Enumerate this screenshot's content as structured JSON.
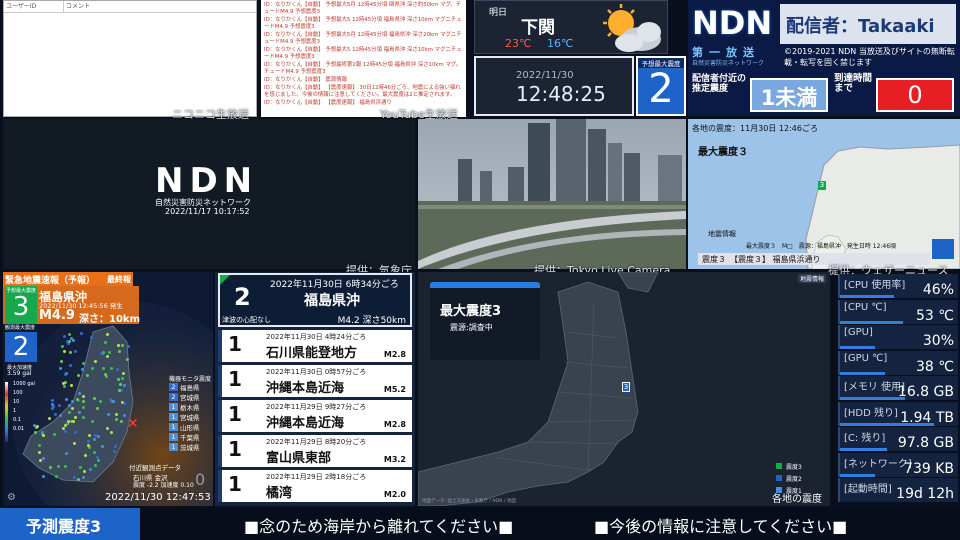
{
  "niconico": {
    "col_user": "ユーザーID",
    "col_comment": "コメント",
    "caption": "ニコニコ生放送"
  },
  "youtube": {
    "caption": "YouTube生放送",
    "comments": [
      "ID：なりかくん【自動】 予想最大5月 12時45分頃 関県沖 深さ約50km マグ。チュードM4.9 予想震度3",
      "ID：なりかくん【自動】 予想最大5 12時45分頃 福島県沖 深さ10km マグニチュードM4.9 予想震度3",
      "ID：なりかくん【自動】 予想最大5月 12時45分頃 福島県沖 深さ20km マグニチュードM4.9 予想震度3",
      "ID：なりかくん【自動】 予想最大5 12時45分頃 福島県沖 深さ10km マグニチュードM4.9 予想震度3",
      "ID：なりかくん【自動】 予想最終第2報 12時45分頃 福島県沖 深さ10km マグ。チュードM4.9 予想震度3",
      "ID：なりかくん【自動】 震源情報",
      "ID：なりかくん【自動】 【震度速報】 30日12時46分ごろ、地震による強い揺れを感じました。今後の情報に注意してください。最大震度は2と推定されます。",
      "ID：なりかくん【自動】 【震度速報】 福島県浜通り"
    ]
  },
  "weather": {
    "label": "明日",
    "city": "下関",
    "high": "23℃",
    "low": "16℃"
  },
  "clock": {
    "date": "2022/11/30",
    "time": "12:48:25",
    "max_label": "予想最大震度",
    "max_value": "2"
  },
  "ndn": {
    "logo": "NDN",
    "streamer": "配信者：Takaaki",
    "sub_logo": "第一放送",
    "sub_logo2": "自然災害防災ネットワーク",
    "copyright": "©2019-2021 NDN 当放送及びサイトの無断転載・転写を固く禁じます",
    "est_label": "配信者付近の推定震度",
    "est_value": "1未満",
    "arrival_label": "到達時間まで",
    "arrival_value": "0"
  },
  "ndn_video": {
    "logo": "NDN",
    "subtitle": "自然災害防災ネットワーク",
    "date": "2022/11/17 10:17:52"
  },
  "camera": {
    "caption": "提供：Tokyo Live Camera"
  },
  "jma_map": {
    "title": "各地の震度：11月30日 12:46ごろ",
    "max_label": "最大震度３",
    "bottom_left": "地震情報",
    "bottom_info": "最大震度３　M□　震源：福島県沖　発生日時 12:46頃",
    "footer": "震度３　【震度３】 福島県浜通り",
    "caption": "提供：気象庁",
    "marker": "3"
  },
  "eew": {
    "header": "緊急地震速報（予報）",
    "header_tag": "最終報",
    "intensity_label": "予想最大震度",
    "intensity": "3",
    "region": "福島県沖",
    "time": "2022/11/30 12:45:56 発生",
    "magnitude": "M4.9",
    "depth": "深さ：10km",
    "observed_label": "観測最大震度",
    "observed": "2",
    "accel_label": "最大加速度",
    "accel_value": "3.59 gal",
    "monitor_title": "機器モニタ震度",
    "monitor": [
      {
        "int": "2",
        "place": "福島県",
        "color": "#2f6ed6"
      },
      {
        "int": "2",
        "place": "宮城県",
        "color": "#2f6ed6"
      },
      {
        "int": "1",
        "place": "栃木県",
        "color": "#4a90d9"
      },
      {
        "int": "1",
        "place": "宮城県",
        "color": "#4a90d9"
      },
      {
        "int": "1",
        "place": "山形県",
        "color": "#4a90d9"
      },
      {
        "int": "1",
        "place": "千葉県",
        "color": "#4a90d9"
      },
      {
        "int": "1",
        "place": "茨城県",
        "color": "#4a90d9"
      }
    ],
    "scale": [
      "1000 gal",
      "100",
      "10",
      "1",
      "0.1",
      "0.01"
    ],
    "bottom_label": "付近観測点データ",
    "bottom_station": "石川県 金沢",
    "bottom_values": "震度 -2.2 加速度 0.10",
    "bottom_num": "0",
    "timestamp": "2022/11/30 12:47:53",
    "caption": "提供：ウェザーニュース"
  },
  "quake_list": {
    "top": {
      "time": "2022年11月30日 6時34分ごろ",
      "int": "2",
      "place": "福島県沖",
      "tsunami": "津波の心配なし",
      "mag": "M4.2 深さ50km"
    },
    "items": [
      {
        "time": "2022年11月30日 4時24分ごろ",
        "int": "1",
        "place": "石川県能登地方",
        "mag": "M2.8"
      },
      {
        "time": "2022年11月30日 0時57分ごろ",
        "int": "1",
        "place": "沖縄本島近海",
        "mag": "M5.2"
      },
      {
        "time": "2022年11月29日 9時27分ごろ",
        "int": "1",
        "place": "沖縄本島近海",
        "mag": "M2.8"
      },
      {
        "time": "2022年11月29日 8時20分ごろ",
        "int": "1",
        "place": "富山県東部",
        "mag": "M3.2"
      },
      {
        "time": "2022年11月29日 2時18分ごろ",
        "int": "1",
        "place": "橘湾",
        "mag": "M2.0"
      }
    ]
  },
  "main_map": {
    "tag": "地震情報",
    "title": "最大震度3",
    "sub": "震源:調査中",
    "marker": "3",
    "legend1": "震度3",
    "legend2": "震度2",
    "legend3": "震度1",
    "footer": "各地の震度",
    "credit": "地図データ: 国土交通省・気象庁 / NDN / 地図"
  },
  "stats": [
    {
      "label": "[CPU 使用率]",
      "value": "46%",
      "fill": 0.46
    },
    {
      "label": "[CPU ℃]",
      "value": "53 ℃",
      "fill": 0.53
    },
    {
      "label": "[GPU]",
      "value": "30%",
      "fill": 0.3
    },
    {
      "label": "[GPU ℃]",
      "value": "38 ℃",
      "fill": 0.38
    },
    {
      "label": "[メモリ 使用]",
      "value": "16.8 GB",
      "fill": 0.55
    },
    {
      "label": "[HDD 残り]",
      "value": "1.94 TB",
      "fill": 0.8
    },
    {
      "label": "[C: 残り]",
      "value": "97.8 GB",
      "fill": 0.4
    },
    {
      "label": "[ネットワーク]",
      "value": "739 KB",
      "fill": 0.3
    },
    {
      "label": "[起動時間]",
      "value": "19d 12h",
      "fill": 0.0
    }
  ],
  "ticker": {
    "left": "予測震度3",
    "msg1": "■念のため海岸から離れてください■",
    "msg2": "■今後の情報に注意してください■"
  },
  "colors": {
    "accent": "#1e63c7",
    "bg": "#0a0f1e",
    "alert_red": "#e81e25",
    "eew_orange": "#e8701a",
    "int3": "#16a84b",
    "int2": "#1e63c7"
  }
}
